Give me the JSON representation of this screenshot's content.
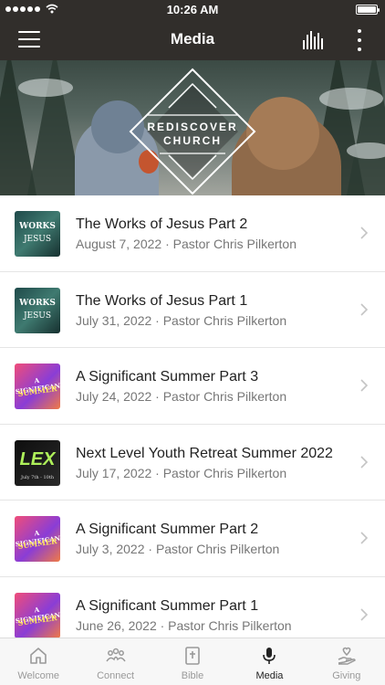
{
  "status": {
    "time": "10:26 AM"
  },
  "nav": {
    "title": "Media"
  },
  "banner": {
    "line1": "REDISCOVER",
    "line2": "CHURCH"
  },
  "media_items": [
    {
      "title": "The Works of Jesus Part 2",
      "subtitle": "August 7, 2022 · Pastor Chris Pilkerton",
      "thumb": "works",
      "thumb_text": [
        "WORKS",
        "JESUS"
      ]
    },
    {
      "title": "The Works of Jesus Part 1",
      "subtitle": "July 31, 2022 · Pastor Chris Pilkerton",
      "thumb": "works",
      "thumb_text": [
        "WORKS",
        "JESUS"
      ]
    },
    {
      "title": "A Significant Summer Part 3",
      "subtitle": "July 24, 2022 · Pastor Chris Pilkerton",
      "thumb": "summer",
      "thumb_text": [
        "A SIGNIFICANT",
        "SUMMER"
      ]
    },
    {
      "title": "Next Level Youth Retreat Summer 2022",
      "subtitle": "July 17, 2022 · Pastor Chris Pilkerton",
      "thumb": "lex",
      "thumb_text": [
        "LEX",
        "July 7th - 10th"
      ]
    },
    {
      "title": "A Significant Summer Part 2",
      "subtitle": "July 3, 2022 · Pastor Chris Pilkerton",
      "thumb": "summer",
      "thumb_text": [
        "A SIGNIFICANT",
        "SUMMER"
      ]
    },
    {
      "title": "A Significant Summer Part 1",
      "subtitle": "June 26, 2022 · Pastor Chris Pilkerton",
      "thumb": "summer",
      "thumb_text": [
        "A SIGNIFICANT",
        "SUMMER"
      ]
    }
  ],
  "tabs": [
    {
      "label": "Welcome",
      "icon": "house-icon"
    },
    {
      "label": "Connect",
      "icon": "people-icon"
    },
    {
      "label": "Bible",
      "icon": "bible-icon"
    },
    {
      "label": "Media",
      "icon": "microphone-icon",
      "active": true
    },
    {
      "label": "Giving",
      "icon": "giving-hand-icon"
    }
  ],
  "colors": {
    "header_bg": "#312e2b",
    "tab_active": "#222222",
    "tab_inactive": "#9a9a9a"
  }
}
